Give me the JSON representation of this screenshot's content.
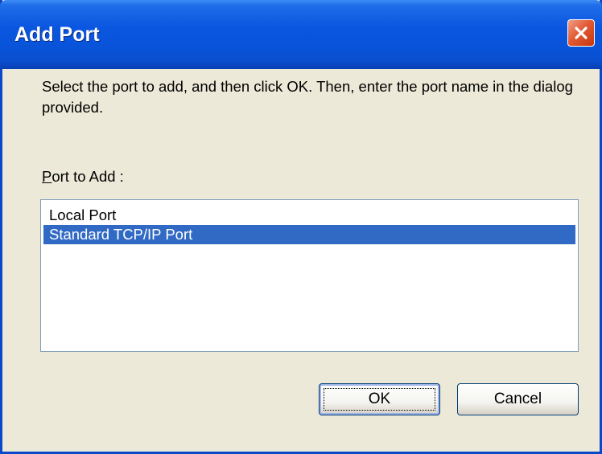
{
  "window": {
    "title": "Add Port",
    "close_icon": "close-icon"
  },
  "message": "Select the port to add, and then click OK. Then, enter the port name in the dialog provided.",
  "port_list": {
    "label_accel": "P",
    "label_rest": "ort to Add :",
    "items": [
      {
        "label": "Local Port",
        "selected": false
      },
      {
        "label": "Standard TCP/IP Port",
        "selected": true
      }
    ]
  },
  "buttons": {
    "ok_label": "OK",
    "cancel_label": "Cancel"
  },
  "colors": {
    "titlebar": "#0a56e0",
    "selection": "#316ac5",
    "close_button": "#e25a34",
    "dialog_bg": "#ece9d8"
  }
}
